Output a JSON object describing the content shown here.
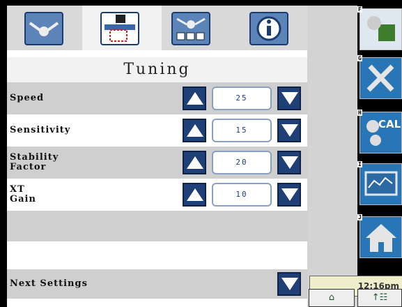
{
  "tabs": [
    {
      "icon": "seed-spray-icon",
      "active": false
    },
    {
      "icon": "implement-height-icon",
      "active": true
    },
    {
      "icon": "checkbox-list-icon",
      "active": false
    },
    {
      "icon": "info-icon",
      "active": false
    }
  ],
  "page_title": "Tuning",
  "settings": [
    {
      "label": "Speed",
      "value": "25"
    },
    {
      "label": "Sensitivity",
      "value": "15"
    },
    {
      "label": "Stability\nFactor",
      "value": "20"
    },
    {
      "label": "XT\nGain",
      "value": "10"
    }
  ],
  "next_settings_label": "Next Settings",
  "softkeys": [
    {
      "key": "F",
      "icon": "paint-bucket-icon"
    },
    {
      "key": "G",
      "icon": "tools-icon"
    },
    {
      "key": "H",
      "icon": "calibration-gears-icon",
      "text": "CAL"
    },
    {
      "key": "I",
      "icon": "chart-monitor-icon"
    },
    {
      "key": "J",
      "icon": "home-icon"
    }
  ],
  "clock": "12:16pm",
  "bottom_buttons": [
    {
      "icon": "home-icon"
    },
    {
      "icon": "up-arrow-grid-icon"
    }
  ]
}
